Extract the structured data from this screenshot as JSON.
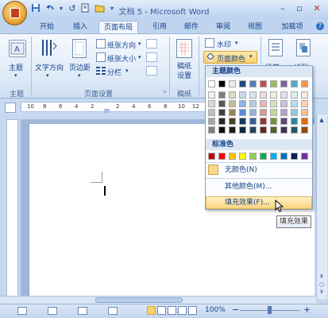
{
  "window": {
    "title": "文档 5 - Microsoft Word",
    "minimize": "–",
    "restore": "▫",
    "close": "✕"
  },
  "qat": {
    "save_icon": "save-icon",
    "undo_icon": "undo-icon",
    "refresh": "↺",
    "more": "▾"
  },
  "tabs": [
    {
      "label": "开始"
    },
    {
      "label": "插入"
    },
    {
      "label": "页面布局"
    },
    {
      "label": "引用"
    },
    {
      "label": "邮件"
    },
    {
      "label": "审阅"
    },
    {
      "label": "视图"
    },
    {
      "label": "加载项"
    }
  ],
  "ribbon": {
    "theme_group": {
      "theme_label": "主题",
      "group_label": "主题"
    },
    "page_setup": {
      "text_direction": "文字方向",
      "margins": "页边距",
      "orientation": "纸张方向",
      "size": "纸张大小",
      "columns": "分栏",
      "group_label": "页面设置"
    },
    "manuscript": {
      "label": "稿纸设置",
      "group_label": "稿纸"
    },
    "page_background": {
      "watermark": "水印",
      "page_color": "页面颜色"
    },
    "paragraph_partial": "段落",
    "arrange_partial": "排列"
  },
  "ruler": {
    "numbers": [
      "10",
      "8",
      "6",
      "4",
      "2",
      "2",
      "4",
      "6",
      "8",
      "10",
      "12"
    ]
  },
  "dropdown": {
    "theme_colors_heading": "主题颜色",
    "standard_colors_heading": "标准色",
    "no_color": "无颜色(N)",
    "more_colors": "其他颜色(M)...",
    "fill_effects": "填充效果(F)...",
    "theme_top_row": [
      "#ffffff",
      "#000000",
      "#eeece1",
      "#1f497d",
      "#4f81bd",
      "#c0504d",
      "#9bbb59",
      "#8064a2",
      "#4bacc6",
      "#f79646"
    ],
    "theme_shades": [
      [
        "#f2f2f2",
        "#7f7f7f",
        "#ddd9c3",
        "#c6d9f0",
        "#dbe5f1",
        "#f2dcdb",
        "#ebf1dd",
        "#e5e0ec",
        "#dbeef3",
        "#fdeada"
      ],
      [
        "#d8d8d8",
        "#595959",
        "#c4bd97",
        "#8db3e2",
        "#b8cce4",
        "#e5b9b7",
        "#d7e3bc",
        "#ccc1d9",
        "#b7dde8",
        "#fbd5b5"
      ],
      [
        "#bfbfbf",
        "#3f3f3f",
        "#938953",
        "#548dd4",
        "#95b3d7",
        "#d99694",
        "#c3d69b",
        "#b2a2c7",
        "#92cddc",
        "#fac08f"
      ],
      [
        "#a5a5a5",
        "#262626",
        "#494429",
        "#17365d",
        "#366092",
        "#953734",
        "#76923c",
        "#5f497a",
        "#31859b",
        "#e36c09"
      ],
      [
        "#7f7f7f",
        "#0c0c0c",
        "#1d1b10",
        "#0f243e",
        "#244061",
        "#632423",
        "#4f6128",
        "#3f3151",
        "#205867",
        "#974806"
      ]
    ],
    "standard_colors": [
      "#c00000",
      "#ff0000",
      "#ffc000",
      "#ffff00",
      "#92d050",
      "#00b050",
      "#00b0f0",
      "#0070c0",
      "#002060",
      "#7030a0"
    ]
  },
  "tooltip": {
    "text": "填充效果"
  },
  "status": {
    "zoom": "100%",
    "zoom_minus": "−",
    "zoom_plus": "+"
  }
}
